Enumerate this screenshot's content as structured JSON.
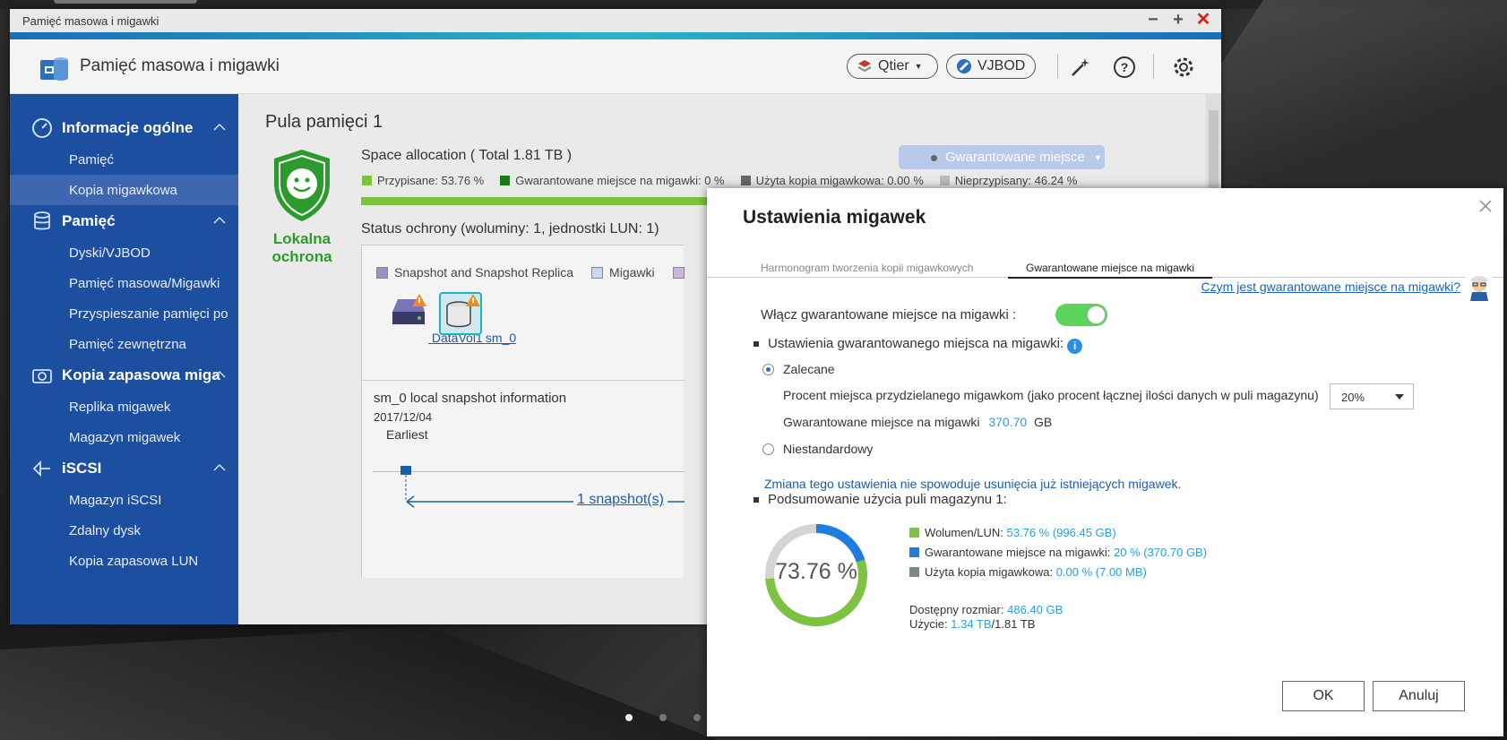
{
  "window": {
    "title": "Pamięć masowa i migawki",
    "app_title": "Pamięć masowa i migawki",
    "qtier_label": "Qtier",
    "vjbod_label": "VJBOD"
  },
  "sidebar": {
    "groups": [
      {
        "label": "Informacje ogólne",
        "items": [
          "Pamięć",
          "Kopia migawkowa"
        ]
      },
      {
        "label": "Pamięć",
        "items": [
          "Dyski/VJBOD",
          "Pamięć masowa/Migawki",
          "Przyspieszanie pamięci po",
          "Pamięć zewnętrzna"
        ]
      },
      {
        "label": "Kopia zapasowa miga",
        "items": [
          "Replika migawek",
          "Magazyn migawek"
        ]
      },
      {
        "label": "iSCSI",
        "items": [
          "Magazyn iSCSI",
          "Zdalny dysk",
          "Kopia zapasowa LUN"
        ]
      }
    ]
  },
  "main": {
    "pool_title": "Pula pamięci 1",
    "protection_label": "Lokalna ochrona",
    "space_title": "Space allocation ( Total 1.81 TB )",
    "guarantee_button": "Gwarantowane miejsce",
    "legend": {
      "assigned": "Przypisane: 53.76 %",
      "guaranteed": "Gwarantowane miejsce na migawki: 0 %",
      "used_snapshot": "Użyta kopia migawkowa: 0.00 %",
      "unassigned": "Nieprzypisany: 46.24 %"
    },
    "assigned_fraction": 0.5376,
    "status_title": "Status ochrony (woluminy: 1, jednostki LUN: 1)",
    "vol_legend": [
      "Snapshot and Snapshot Replica",
      "Migawki",
      ""
    ],
    "volumes": [
      "DataVol1",
      "sm_0"
    ],
    "snap_info": "sm_0 local snapshot information",
    "snap_date": "2017/12/04",
    "earliest": "Earliest",
    "snapshot_count": "1 snapshot(s)"
  },
  "dialog": {
    "title": "Ustawienia migawek",
    "tabs": [
      "Harmonogram tworzenia kopii migawkowych",
      "Gwarantowane miejsce na migawki"
    ],
    "help_link": "Czym jest gwarantowane miejsce na migawki?",
    "enable_label": "Włącz gwarantowane miejsce na migawki :",
    "enabled": true,
    "settings_heading": "Ustawienia gwarantowanego miejsca na migawki:",
    "recommended": "Zalecane",
    "percent_label": "Procent miejsca przydzielanego migawkom (jako procent łącznej ilości danych w puli magazynu)",
    "percent_value": "20%",
    "guaranteed_label": "Gwarantowane miejsce na migawki",
    "guaranteed_value": "370.70",
    "guaranteed_unit": "GB",
    "custom": "Niestandardowy",
    "note": "Zmiana tego ustawienia nie spowoduje usunięcia już istniejących migawek.",
    "summary_heading": "Podsumowanie użycia puli magazynu 1:",
    "donut_label": "73.76 %",
    "donut_fractions": {
      "volume": 0.5376,
      "guaranteed": 0.2,
      "used": 0.0
    },
    "legend": [
      {
        "label": "Wolumen/LUN:",
        "value": "53.76 % (996.45 GB)",
        "color": "#7dc241"
      },
      {
        "label": "Gwarantowane miejsce na migawki:",
        "value": "20 % (370.70 GB)",
        "color": "#1e7ee0"
      },
      {
        "label": "Użyta kopia migawkowa:",
        "value": "0.00 % (7.00 MB)",
        "color": "#7a8a80"
      }
    ],
    "available_label": "Dostępny rozmiar:",
    "available_value": "486.40 GB",
    "usage_label": "Użycie:",
    "usage_used": "1.34 TB",
    "usage_total": "/1.81 TB",
    "ok": "OK",
    "cancel": "Anuluj"
  }
}
